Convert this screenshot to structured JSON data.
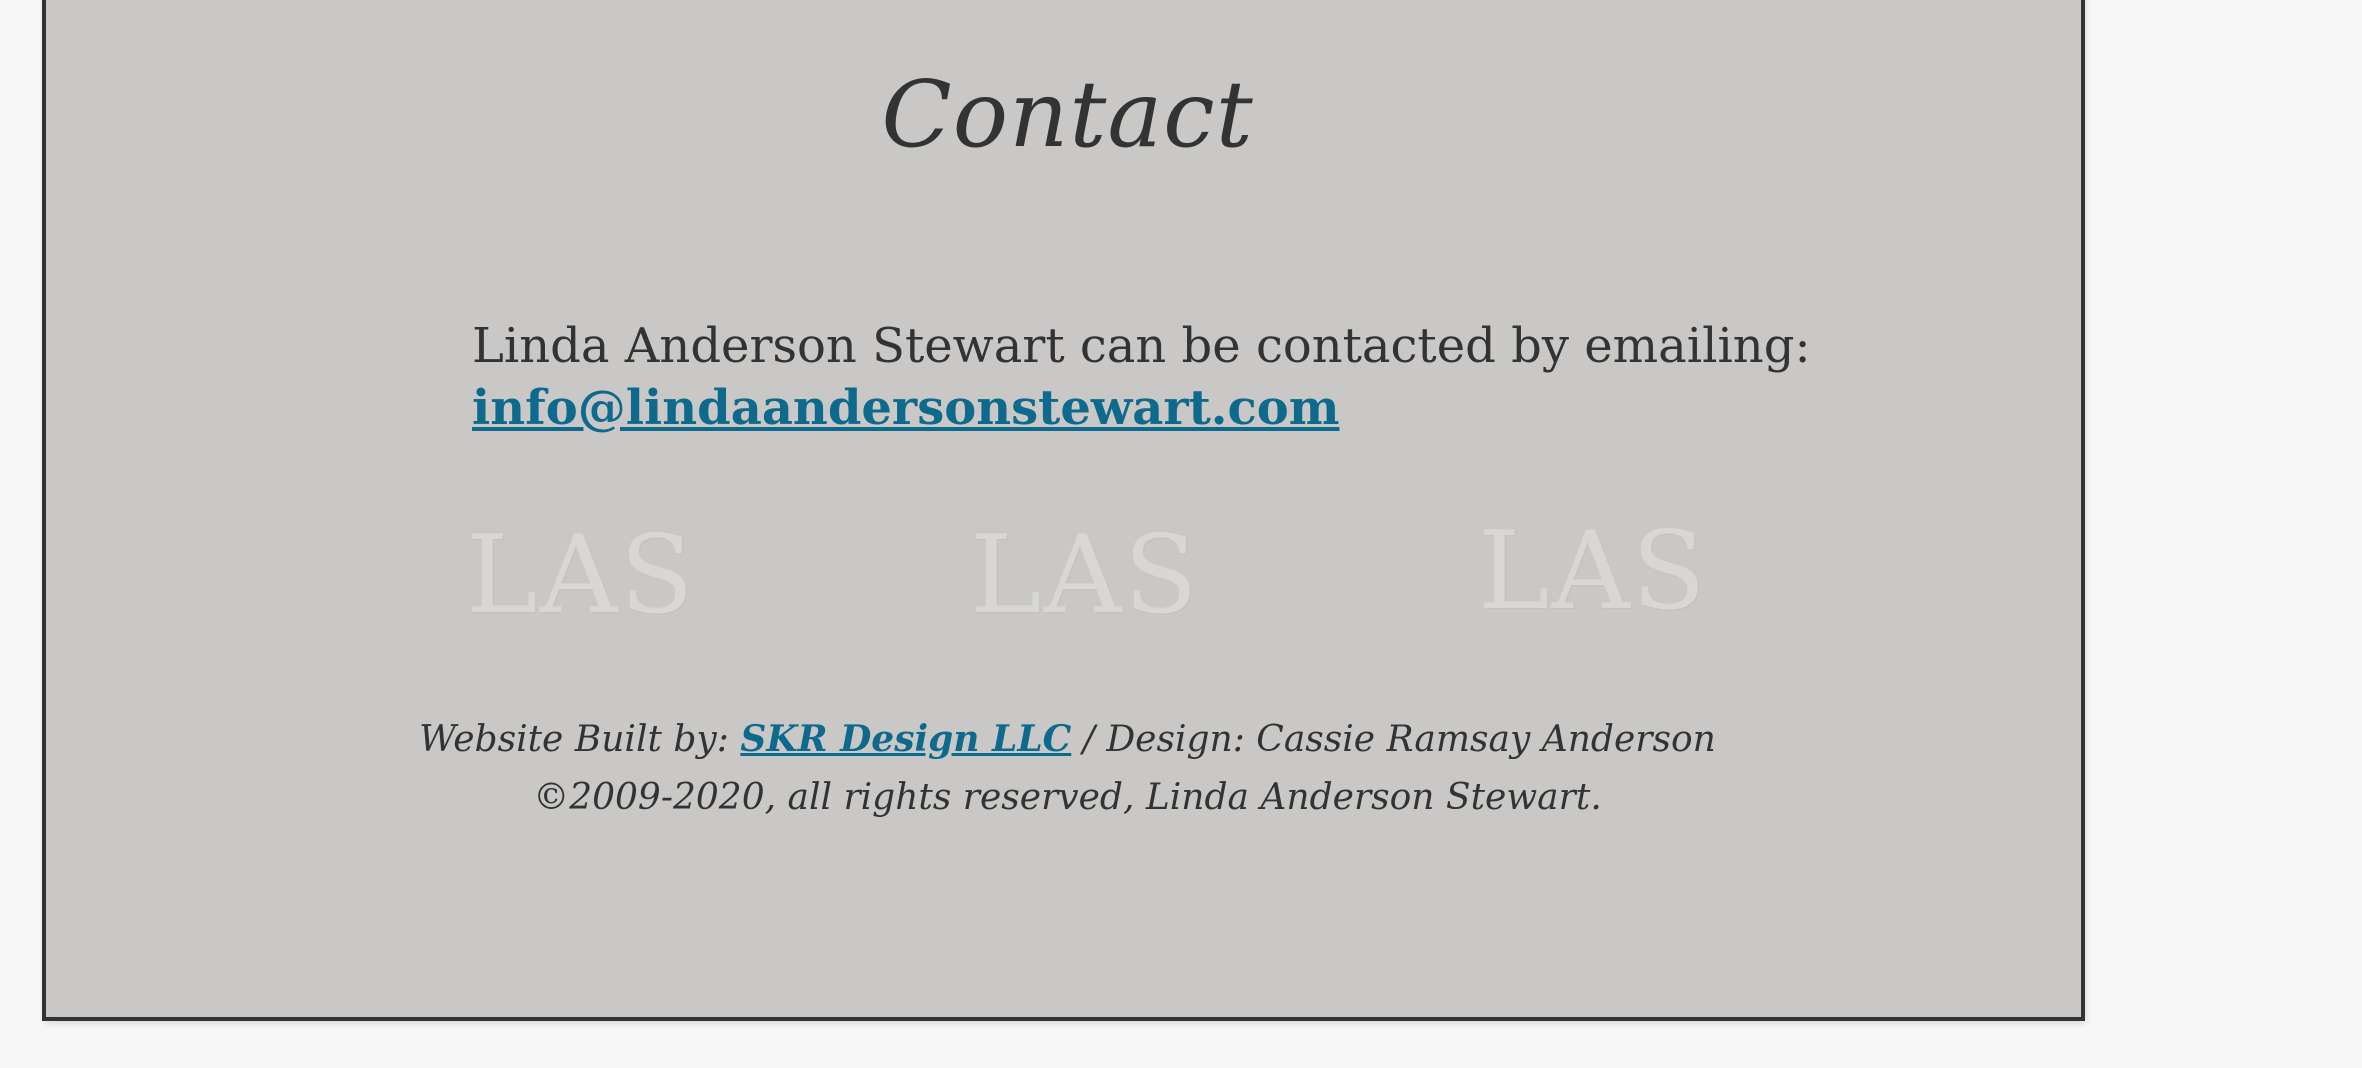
{
  "page": {
    "title": "Contact",
    "contact_text": "Linda Anderson Stewart can be contacted by emailing:",
    "email": "info@lindaandersonstewart.com",
    "watermarks": [
      "LAS",
      "LAS",
      "LAS"
    ],
    "footer": {
      "built_by_prefix": "Website Built by: ",
      "built_by_link": "SKR Design LLC",
      "design_credit": "  / Design: Cassie Ramsay Anderson",
      "copyright": "©2009-2020, all rights reserved, Linda Anderson Stewart."
    }
  },
  "colors": {
    "background": "#f7f7f7",
    "panel": "#c9c8c6",
    "border": "#333333",
    "text": "#333333",
    "link": "#0e6a8c",
    "watermark": "#d8d7d5"
  }
}
